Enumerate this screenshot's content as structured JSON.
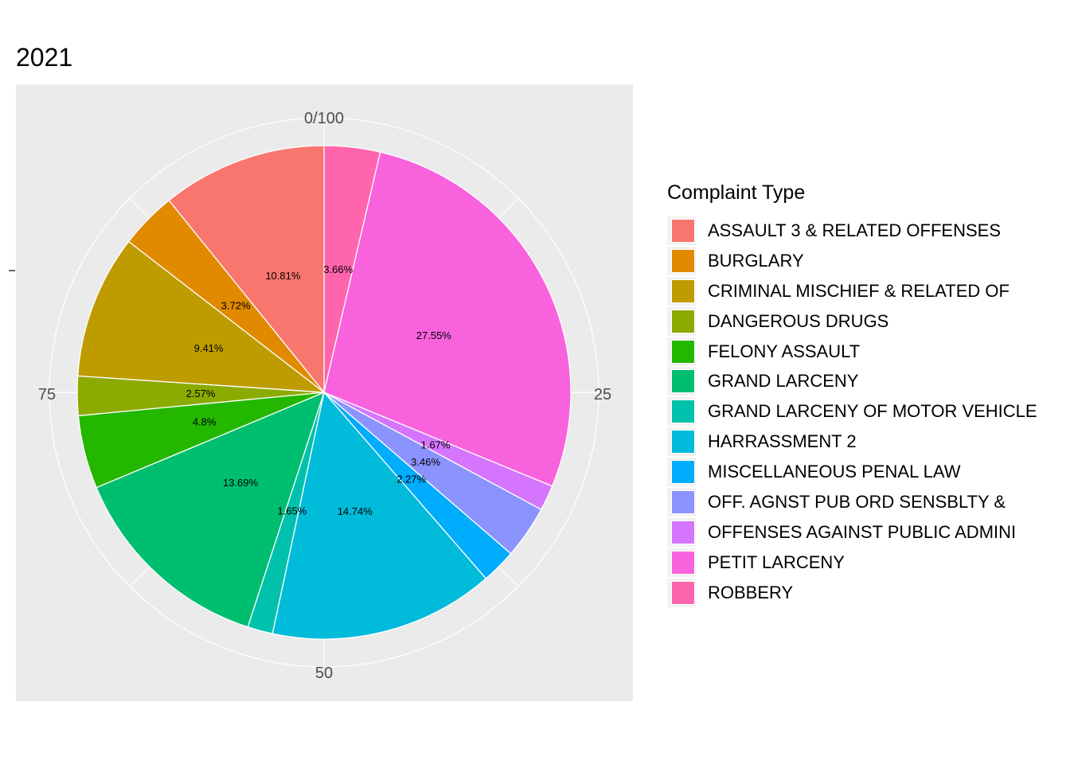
{
  "chart_data": {
    "type": "pie",
    "title": "2021",
    "legend_title": "Complaint Type",
    "legend_position": "right",
    "theta_ticks": [
      "0/100",
      "25",
      "50",
      "75"
    ],
    "categories": [
      "ASSAULT 3 & RELATED OFFENSES",
      "BURGLARY",
      "CRIMINAL MISCHIEF & RELATED OF",
      "DANGEROUS DRUGS",
      "FELONY ASSAULT",
      "GRAND LARCENY",
      "GRAND LARCENY OF MOTOR VEHICLE",
      "HARRASSMENT 2",
      "MISCELLANEOUS PENAL LAW",
      "OFF. AGNST PUB ORD SENSBLTY &",
      "OFFENSES AGAINST PUBLIC ADMINI",
      "PETIT LARCENY",
      "ROBBERY"
    ],
    "values": [
      10.81,
      3.72,
      9.41,
      2.57,
      4.8,
      13.69,
      1.65,
      14.74,
      2.27,
      3.46,
      1.67,
      27.55,
      3.66
    ],
    "labels": [
      "10.81%",
      "3.72%",
      "9.41%",
      "2.57%",
      "4.8%",
      "13.69%",
      "1.65%",
      "14.74%",
      "2.27%",
      "3.46%",
      "1.67%",
      "27.55%",
      "3.66%"
    ],
    "colors": [
      "#F8766D",
      "#E18A00",
      "#BE9C00",
      "#8CAB00",
      "#24B700",
      "#00BE70",
      "#00C1AB",
      "#00BBDA",
      "#00ACFC",
      "#8B93FF",
      "#D575FE",
      "#F962DD",
      "#FF65AC"
    ],
    "panel_background": "#ebebeb",
    "grid_color": "#ffffff"
  }
}
